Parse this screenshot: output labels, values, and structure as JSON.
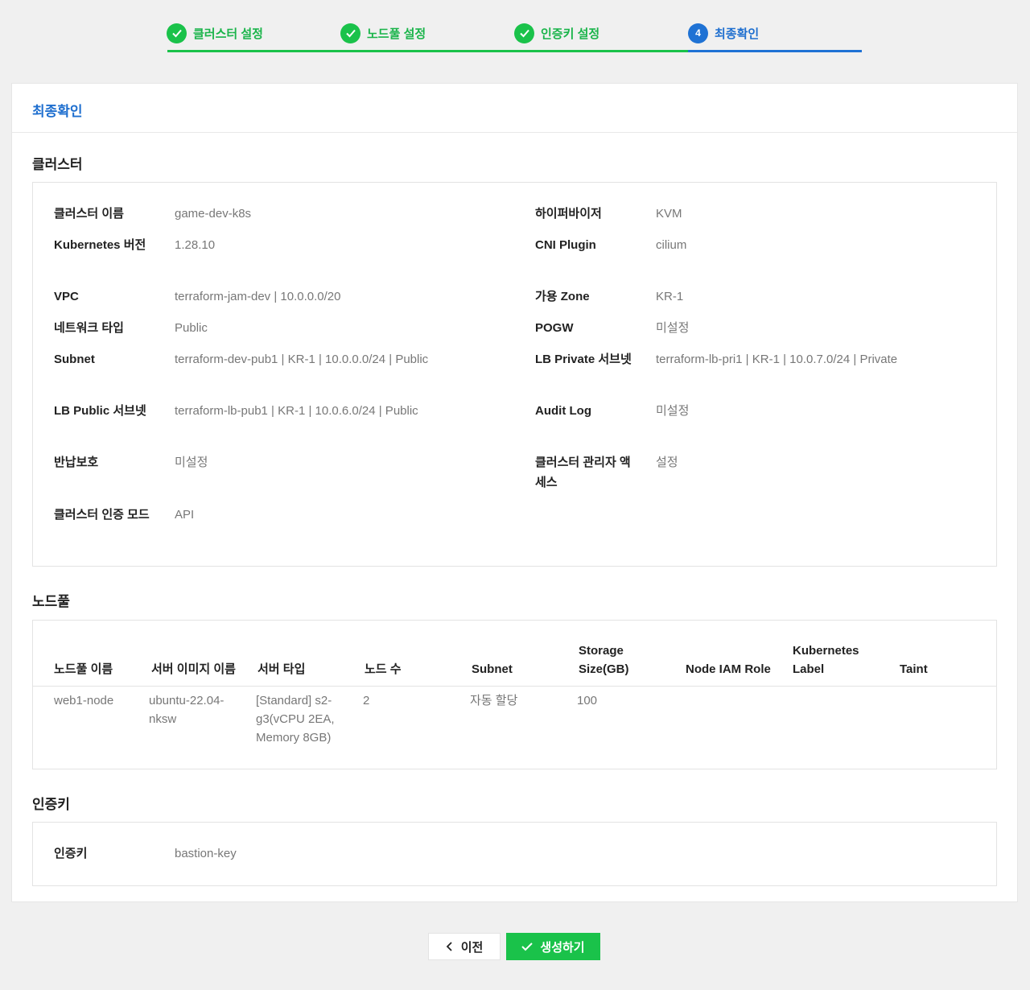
{
  "stepper": {
    "steps": [
      {
        "label": "클러스터 설정",
        "state": "done"
      },
      {
        "label": "노드풀 설정",
        "state": "done"
      },
      {
        "label": "인증키 설정",
        "state": "done"
      },
      {
        "label": "최종확인",
        "state": "active",
        "number": "4"
      }
    ]
  },
  "card": {
    "title": "최종확인"
  },
  "cluster": {
    "title": "클러스터",
    "fields": [
      {
        "label": "클러스터 이름",
        "value": "game-dev-k8s"
      },
      {
        "label": "하이퍼바이저",
        "value": "KVM"
      },
      {
        "label": "Kubernetes 버전",
        "value": "1.28.10"
      },
      {
        "label": "CNI Plugin",
        "value": "cilium"
      },
      {
        "label": "VPC",
        "value": "terraform-jam-dev | 10.0.0.0/20"
      },
      {
        "label": "가용 Zone",
        "value": "KR-1"
      },
      {
        "label": "네트워크 타입",
        "value": "Public"
      },
      {
        "label": "POGW",
        "value": "미설정"
      },
      {
        "label": "Subnet",
        "value": "terraform-dev-pub1 | KR-1 | 10.0.0.0/24 | Public"
      },
      {
        "label": "LB Private 서브넷",
        "value": "terraform-lb-pri1 | KR-1 | 10.0.7.0/24 | Private"
      },
      {
        "label": "LB Public 서브넷",
        "value": "terraform-lb-pub1 | KR-1 | 10.0.6.0/24 | Public"
      },
      {
        "label": "Audit Log",
        "value": "미설정"
      },
      {
        "label": "반납보호",
        "value": "미설정"
      },
      {
        "label": "클러스터 관리자 액세스",
        "value": "설정"
      },
      {
        "label": "클러스터 인증 모드",
        "value": "API"
      }
    ]
  },
  "nodepool": {
    "title": "노드풀",
    "columns": [
      "노드풀 이름",
      "서버 이미지 이름",
      "서버 타입",
      "노드 수",
      "Subnet",
      "Storage Size(GB)",
      "Node IAM Role",
      "Kubernetes Label",
      "Taint"
    ],
    "rows": [
      [
        "web1-node",
        "ubuntu-22.04-nksw",
        "[Standard] s2-g3(vCPU 2EA, Memory 8GB)",
        "2",
        "자동 할당",
        "100",
        "",
        "",
        ""
      ]
    ]
  },
  "authkey": {
    "title": "인증키",
    "label": "인증키",
    "value": "bastion-key"
  },
  "buttons": {
    "prev": "이전",
    "create": "생성하기"
  }
}
